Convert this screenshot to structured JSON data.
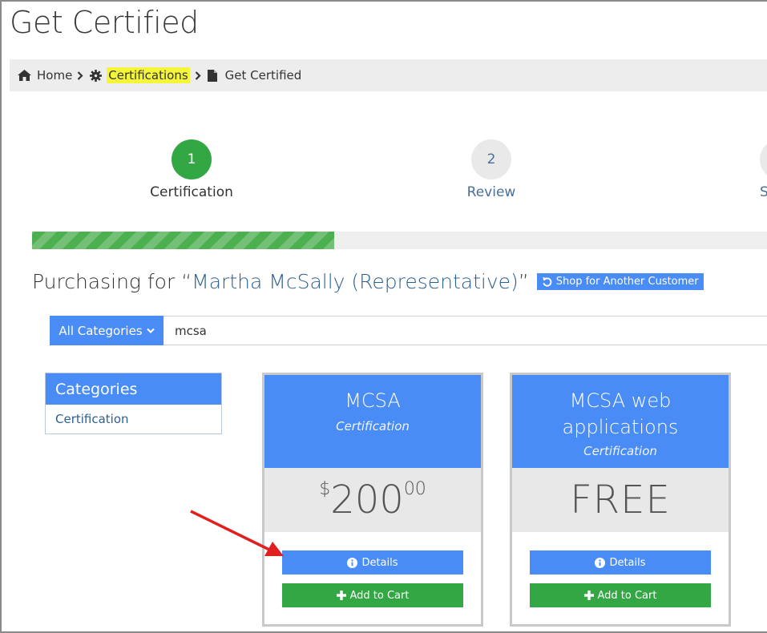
{
  "page": {
    "title": "Get Certified"
  },
  "breadcrumb": {
    "home": "Home",
    "certifications": "Certifications",
    "current": "Get Certified"
  },
  "steps": [
    {
      "number": "1",
      "label": "Certification",
      "state": "active"
    },
    {
      "number": "2",
      "label": "Review",
      "state": "pending"
    },
    {
      "number": "3",
      "label": "S",
      "state": "pending"
    }
  ],
  "progress": {
    "percent": 41
  },
  "purchasing": {
    "prefix": "Purchasing for “",
    "customer": "Martha McSally (Representative)",
    "suffix": "”",
    "shop_another_label": "Shop for Another Customer"
  },
  "search": {
    "category_label": "All Categories",
    "query": "mcsa"
  },
  "categories": {
    "heading": "Categories",
    "items": [
      "Certification"
    ]
  },
  "products": [
    {
      "title": "MCSA",
      "type": "Certification",
      "price": {
        "currency": "$",
        "amount": "200",
        "cents": "00"
      },
      "details_label": "Details",
      "cart_label": "Add to Cart"
    },
    {
      "title": "MCSA web applications",
      "type": "Certification",
      "price": {
        "free": "FREE"
      },
      "details_label": "Details",
      "cart_label": "Add to Cart"
    }
  ],
  "colors": {
    "primary": "#4a8cf5",
    "success": "#34a745",
    "link": "#2d5f8f",
    "highlight": "#f5f53a",
    "annotation_arrow": "#e02020"
  }
}
